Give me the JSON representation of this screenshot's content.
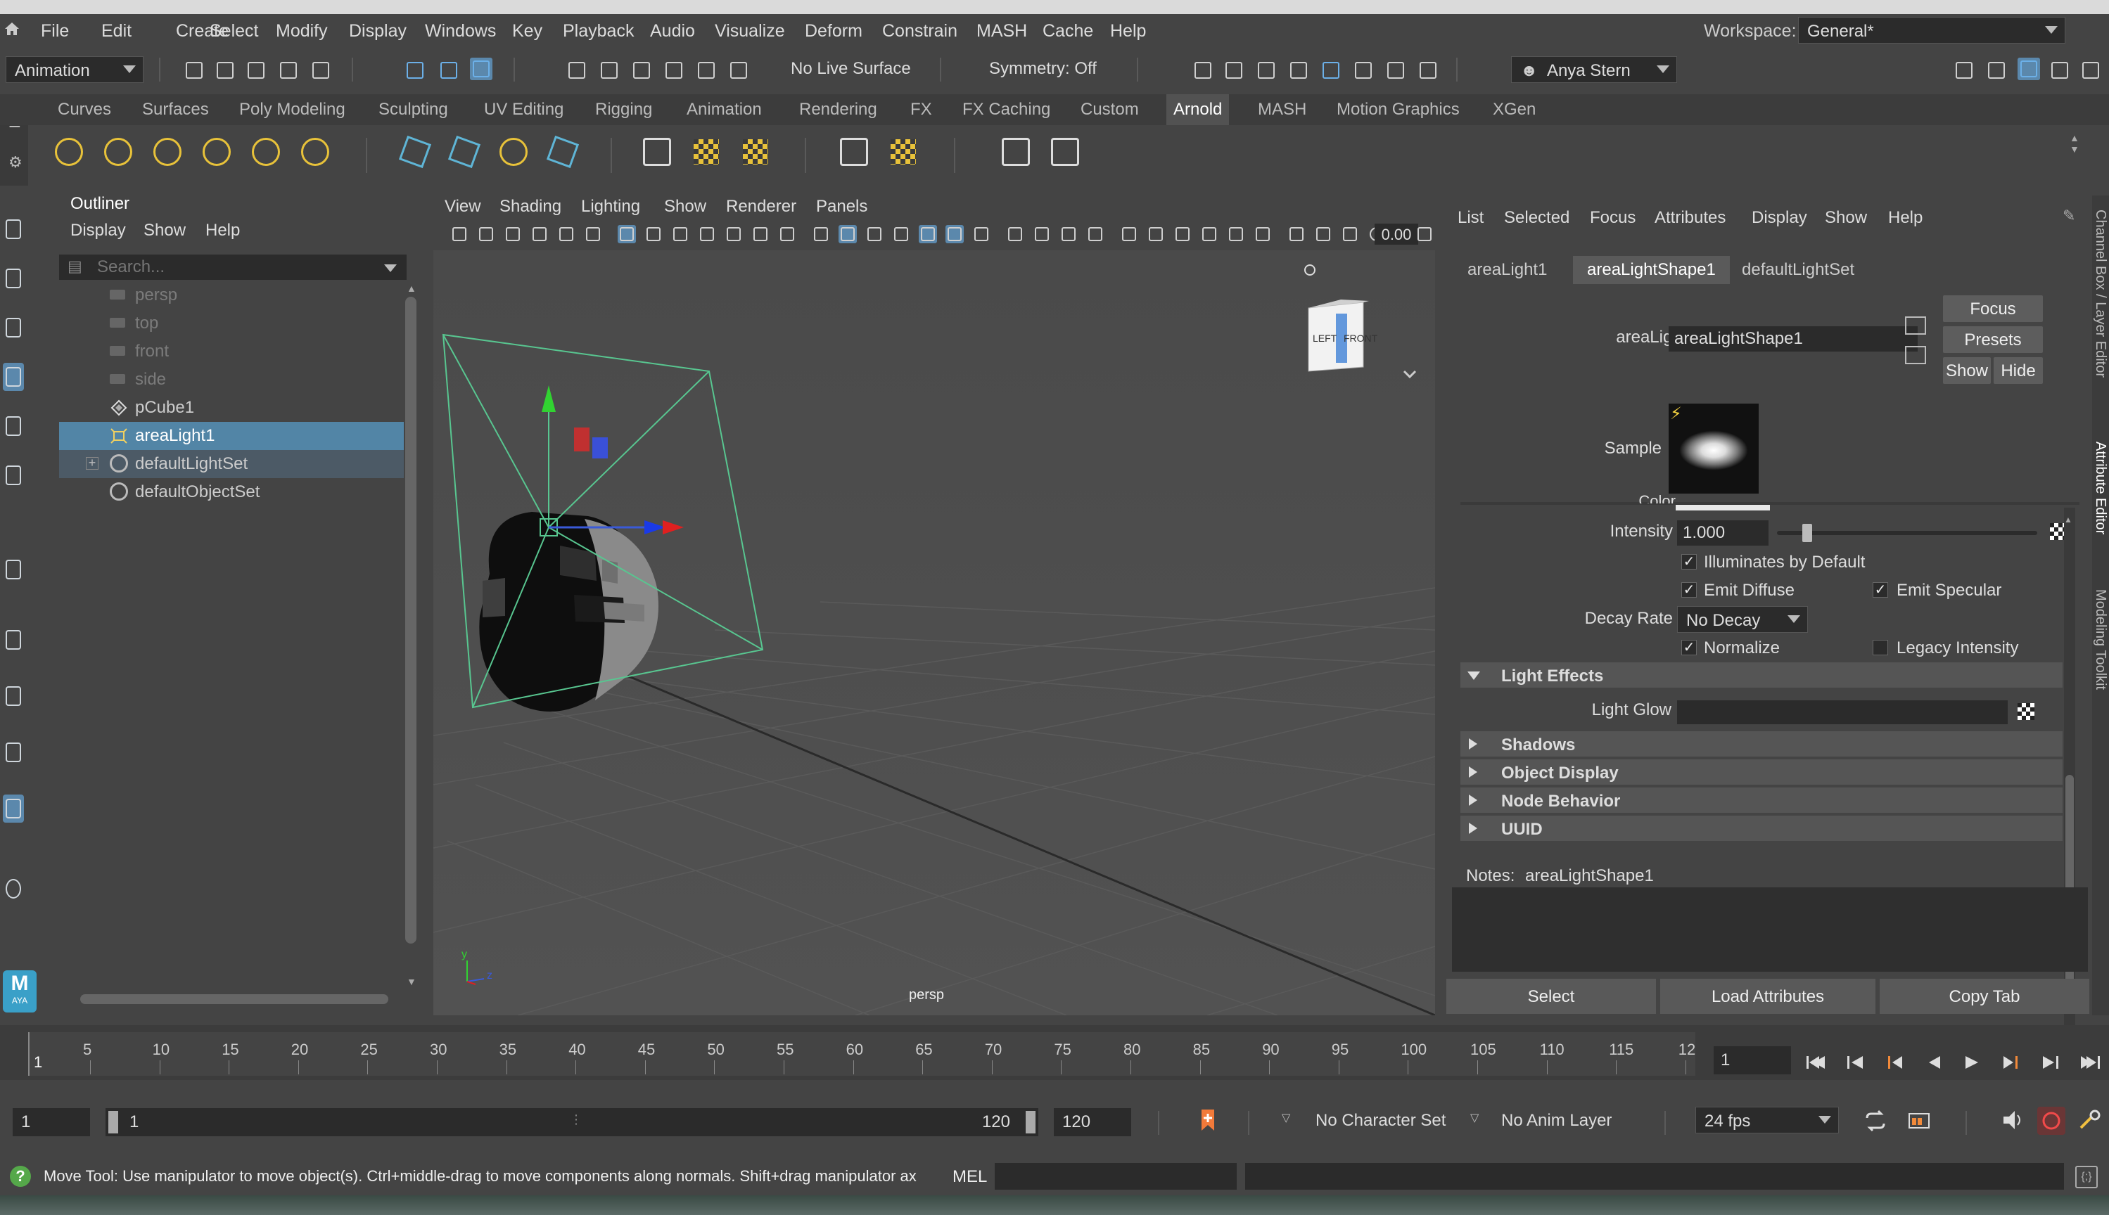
{
  "menubar": {
    "items": [
      "File",
      "Edit",
      "Create",
      "Select",
      "Modify",
      "Display",
      "Windows",
      "Key",
      "Playback",
      "Audio",
      "Visualize",
      "Deform",
      "Constrain",
      "MASH",
      "Cache",
      "Help"
    ],
    "workspace_label": "Workspace:",
    "workspace_value": "General*"
  },
  "statusline": {
    "mode_value": "Animation",
    "live_surface": "No Live Surface",
    "symmetry": "Symmetry: Off",
    "user": "Anya Stern"
  },
  "shelf": {
    "tabs": [
      "Curves",
      "Surfaces",
      "Poly Modeling",
      "Sculpting",
      "UV Editing",
      "Rigging",
      "Animation",
      "Rendering",
      "FX",
      "FX Caching",
      "Custom",
      "Arnold",
      "MASH",
      "Motion Graphics",
      "XGen"
    ],
    "active_tab": "Arnold"
  },
  "outliner": {
    "title": "Outliner",
    "menus": [
      "Display",
      "Show",
      "Help"
    ],
    "search_placeholder": "Search...",
    "items": [
      {
        "label": "persp",
        "kind": "camera",
        "dim": true
      },
      {
        "label": "top",
        "kind": "camera",
        "dim": true
      },
      {
        "label": "front",
        "kind": "camera",
        "dim": true
      },
      {
        "label": "side",
        "kind": "camera",
        "dim": true
      },
      {
        "label": "pCube1",
        "kind": "mesh",
        "dim": false
      },
      {
        "label": "areaLight1",
        "kind": "light",
        "dim": false,
        "selected": true
      },
      {
        "label": "defaultLightSet",
        "kind": "set",
        "dim": false
      },
      {
        "label": "defaultObjectSet",
        "kind": "set",
        "dim": false
      }
    ]
  },
  "viewport": {
    "menus": [
      "View",
      "Shading",
      "Lighting",
      "Show",
      "Renderer",
      "Panels"
    ],
    "time_value": "0.00",
    "camera_label": "persp",
    "viewcube_left": "LEFT",
    "viewcube_front": "FRONT",
    "axis_y": "y",
    "axis_z": "z"
  },
  "attribute_editor": {
    "menus": [
      "List",
      "Selected",
      "Focus",
      "Attributes",
      "Display",
      "Show",
      "Help"
    ],
    "tabs": [
      "areaLight1",
      "areaLightShape1",
      "defaultLightSet"
    ],
    "active_tab": "areaLightShape1",
    "node_label": "areaLight:",
    "node_value": "areaLightShape1",
    "buttons": {
      "focus": "Focus",
      "presets": "Presets",
      "show": "Show",
      "hide": "Hide"
    },
    "sample_label": "Sample",
    "color_label": "Color",
    "intensity_label": "Intensity",
    "intensity_value": "1.000",
    "intensity_fraction": 0.1,
    "illuminates_by_default": "Illuminates by Default",
    "emit_diffuse": "Emit Diffuse",
    "emit_specular": "Emit Specular",
    "decay_rate_label": "Decay Rate",
    "decay_rate_value": "No Decay",
    "normalize": "Normalize",
    "legacy_intensity": "Legacy Intensity",
    "sections": {
      "light_effects": "Light Effects",
      "light_glow": "Light Glow",
      "shadows": "Shadows",
      "object_display": "Object Display",
      "node_behavior": "Node Behavior",
      "uuid": "UUID"
    },
    "notes_label": "Notes:",
    "notes_value": "areaLightShape1",
    "bottom_buttons": {
      "select": "Select",
      "load": "Load Attributes",
      "copy": "Copy Tab"
    }
  },
  "sidestrip": {
    "channel_box": "Channel Box / Layer Editor",
    "attribute_editor": "Attribute Editor",
    "modeling_toolkit": "Modeling Toolkit"
  },
  "timeline": {
    "ticks": [
      "5",
      "10",
      "15",
      "20",
      "25",
      "30",
      "35",
      "40",
      "45",
      "50",
      "55",
      "60",
      "65",
      "70",
      "75",
      "80",
      "85",
      "90",
      "95",
      "100",
      "105",
      "110",
      "115",
      "12"
    ],
    "start_frame_label": "1",
    "current_frame": "1"
  },
  "range": {
    "start": "1",
    "range_start": "1",
    "range_end": "120",
    "end": "120",
    "character_set": "No Character Set",
    "anim_layer": "No Anim Layer",
    "fps": "24 fps"
  },
  "cmdline": {
    "help_text": "Move Tool: Use manipulator to move object(s). Ctrl+middle-drag to move components along normals. Shift+drag manipulator ax",
    "mel_label": "MEL"
  }
}
